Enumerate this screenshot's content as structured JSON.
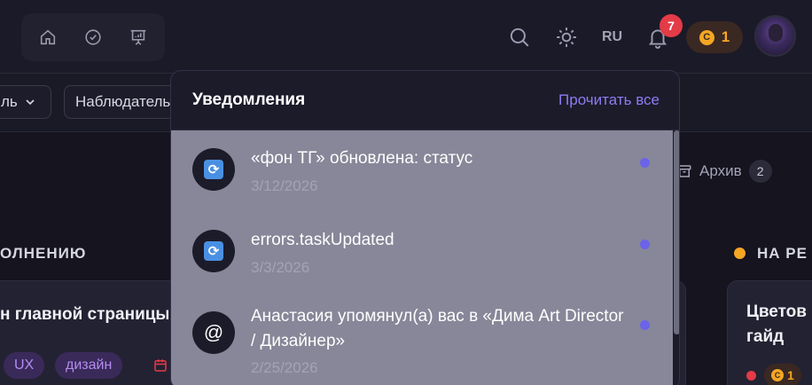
{
  "header": {
    "language": "RU",
    "notification_count": "7",
    "coins": {
      "icon_label": "C",
      "count": "1"
    },
    "icons": [
      "home-icon",
      "check-circle-icon",
      "presentation-icon",
      "search-icon",
      "sun-icon",
      "bell-icon"
    ]
  },
  "filters": {
    "first_label": "ль",
    "second_label": "Наблюдатель"
  },
  "archive": {
    "label": "Архив",
    "count": "2"
  },
  "columns": {
    "left_heading": "ОЛНЕНИЮ",
    "right_heading": "НА РЕ"
  },
  "cards": {
    "left_title": "н главной страницы",
    "tag_ux": "UX",
    "tag_design": "дизайн",
    "right_title_line1": "Цветов",
    "right_title_line2": "гайд",
    "right_coin_count": "1"
  },
  "notifications": {
    "title": "Уведомления",
    "read_all": "Прочитать все",
    "items": [
      {
        "text": "«фон ТГ» обновлена: статус",
        "date": "3/12/2026",
        "icon": "sync-icon"
      },
      {
        "text": "errors.taskUpdated",
        "date": "3/3/2026",
        "icon": "sync-icon"
      },
      {
        "text": "Анастасия упомянул(а) вас в «Дима Art Director / Дизайнер»",
        "date": "2/25/2026",
        "icon": "at-icon"
      }
    ]
  },
  "colors": {
    "accent": "#8b7cf4",
    "badge": "#e33b47",
    "coin": "#f5a623",
    "unread_dot": "#6b63e8"
  }
}
